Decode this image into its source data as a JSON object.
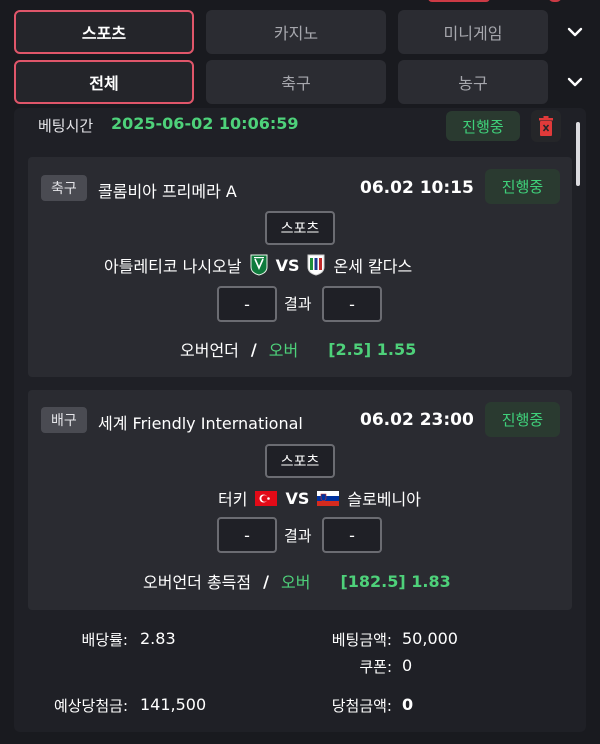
{
  "category_tabs": [
    "스포츠",
    "카지노",
    "미니게임"
  ],
  "filter_tabs": [
    "전체",
    "축구",
    "농구"
  ],
  "bet_time": {
    "label": "베팅시간",
    "value": "2025-06-02 10:06:59",
    "status": "진행중"
  },
  "games": [
    {
      "sport": "축구",
      "league": "콜롬비아 프리메라 A",
      "time": "06.02 10:15",
      "status": "진행중",
      "type_tag": "스포츠",
      "home": "아틀레티코 나시오날",
      "vs": "VS",
      "away": "온세 칼다스",
      "home_score": "-",
      "result_label": "결과",
      "away_score": "-",
      "market": "오버언더",
      "sep": "/",
      "pick": "오버",
      "odds": "[2.5] 1.55"
    },
    {
      "sport": "배구",
      "league": "세계 Friendly International",
      "time": "06.02 23:00",
      "status": "진행중",
      "type_tag": "스포츠",
      "home": "터키",
      "vs": "VS",
      "away": "슬로베니아",
      "home_score": "-",
      "result_label": "결과",
      "away_score": "-",
      "market": "오버언더 총득점",
      "sep": "/",
      "pick": "오버",
      "odds": "[182.5] 1.83"
    }
  ],
  "summary": {
    "odds_label": "배당률:",
    "odds_value": "2.83",
    "bet_amount_label": "베팅금액:",
    "bet_amount_value": "50,000",
    "coupon_label": "쿠폰:",
    "coupon_value": "0",
    "expected_label": "예상당첨금:",
    "expected_value": "141,500",
    "win_amount_label": "당첨금액:",
    "win_amount_value": "0"
  },
  "colors": {
    "accent_red": "#e0566a",
    "green": "#4ed17a"
  }
}
